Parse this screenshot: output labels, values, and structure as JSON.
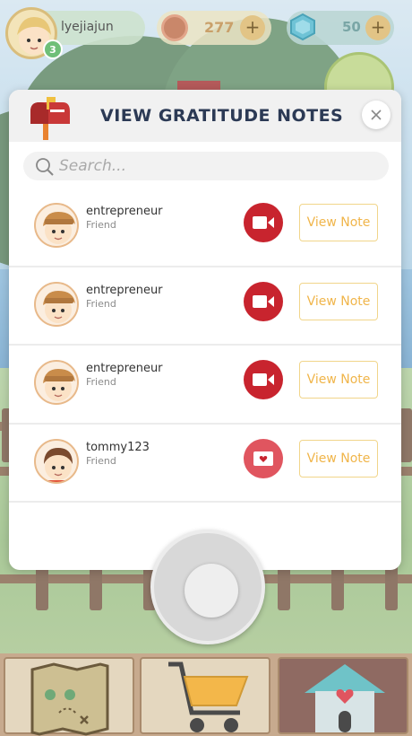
{
  "hud": {
    "username": "lyejiajun",
    "level": "3",
    "coins": "277",
    "gems": "50",
    "plus": "+"
  },
  "modal": {
    "title": "VIEW GRATITUDE NOTES",
    "search_placeholder": "Search...",
    "view_label": "View Note",
    "notes": [
      {
        "name": "entrepreneur",
        "role": "Friend",
        "type": "video-icon",
        "color": "#c8242e"
      },
      {
        "name": "entrepreneur",
        "role": "Friend",
        "type": "video-icon",
        "color": "#c8242e"
      },
      {
        "name": "entrepreneur",
        "role": "Friend",
        "type": "video-icon",
        "color": "#c8242e"
      },
      {
        "name": "tommy123",
        "role": "Friend",
        "type": "letter-icon",
        "color": "#e0555f"
      }
    ]
  },
  "bottom_bar": [
    "map-icon",
    "cart-icon",
    "home-icon"
  ]
}
